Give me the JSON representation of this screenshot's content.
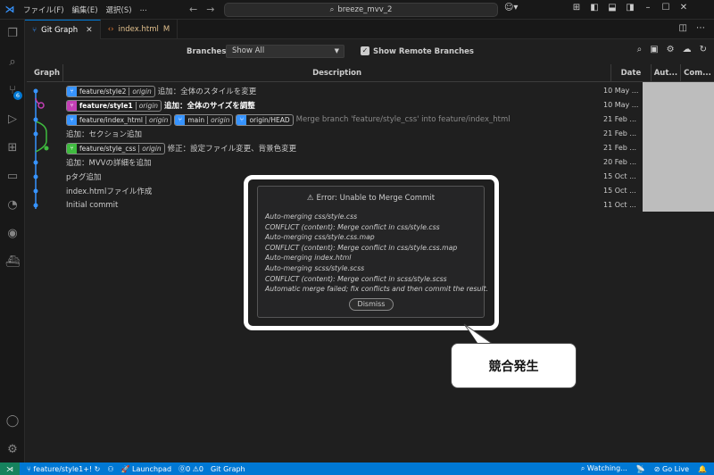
{
  "menu": [
    "ファイル(F)",
    "編集(E)",
    "選択(S)",
    "..."
  ],
  "search": {
    "text": "breeze_mvv_2"
  },
  "activity_badge": "6",
  "tabs": [
    {
      "label": "Git Graph",
      "active": true
    },
    {
      "label": "index.html",
      "modified": "M"
    }
  ],
  "controls": {
    "branches_label": "Branches:",
    "branches_value": "Show All",
    "show_remote_label": "Show Remote Branches"
  },
  "table": {
    "headers": [
      "Graph",
      "Description",
      "Date",
      "Aut...",
      "Com..."
    ],
    "rows": [
      {
        "refs": [
          {
            "name": "feature/style2",
            "remote": "origin",
            "color": "#3794ff"
          }
        ],
        "message": "追加：全体のスタイルを変更",
        "date": "10 May ..."
      },
      {
        "refs": [
          {
            "name": "feature/style1",
            "remote": "origin",
            "color": "#c33fb5"
          }
        ],
        "message": "追加：全体のサイズを調整",
        "date": "10 May ...",
        "bold": true
      },
      {
        "refs": [
          {
            "name": "feature/index_html",
            "remote": "origin",
            "color": "#3794ff"
          },
          {
            "name": "main",
            "remote": "origin",
            "color": "#3794ff"
          },
          {
            "name": "origin/HEAD",
            "color": "#3794ff"
          }
        ],
        "message": "Merge branch 'feature/style_css' into feature/index_html",
        "date": "21 Feb ...",
        "dim": true
      },
      {
        "refs": [],
        "message": "追加：セクション追加",
        "date": "21 Feb ..."
      },
      {
        "refs": [
          {
            "name": "feature/style_css",
            "remote": "origin",
            "color": "#3fbb3f"
          }
        ],
        "message": "修正：設定ファイル変更、背景色変更",
        "date": "21 Feb ..."
      },
      {
        "refs": [],
        "message": "追加：MVVの詳細を追加",
        "date": "20 Feb ..."
      },
      {
        "refs": [],
        "message": "pタグ追加",
        "date": "15 Oct ..."
      },
      {
        "refs": [],
        "message": "index.htmlファイル作成",
        "date": "15 Oct ..."
      },
      {
        "refs": [],
        "message": "Initial commit",
        "date": "11 Oct ..."
      }
    ]
  },
  "dialog": {
    "title": "Error: Unable to Merge Commit",
    "lines": [
      "Auto-merging css/style.css",
      "CONFLICT (content): Merge conflict in css/style.css",
      "Auto-merging css/style.css.map",
      "CONFLICT (content): Merge conflict in css/style.css.map",
      "Auto-merging index.html",
      "Auto-merging scss/style.scss",
      "CONFLICT (content): Merge conflict in scss/style.scss",
      "Automatic merge failed; fix conflicts and then commit the result."
    ],
    "dismiss": "Dismiss"
  },
  "callout": "競合発生",
  "statusbar": {
    "branch": "feature/style1+!",
    "launchpad": "Launchpad",
    "problems": "⓪0 ⚠0",
    "git_graph": "Git Graph",
    "watching": "Watching...",
    "golive": "Go Live"
  },
  "colors": {
    "accent": "#0078d4",
    "blue": "#3794ff",
    "magenta": "#c33fb5",
    "green": "#3fbb3f"
  }
}
